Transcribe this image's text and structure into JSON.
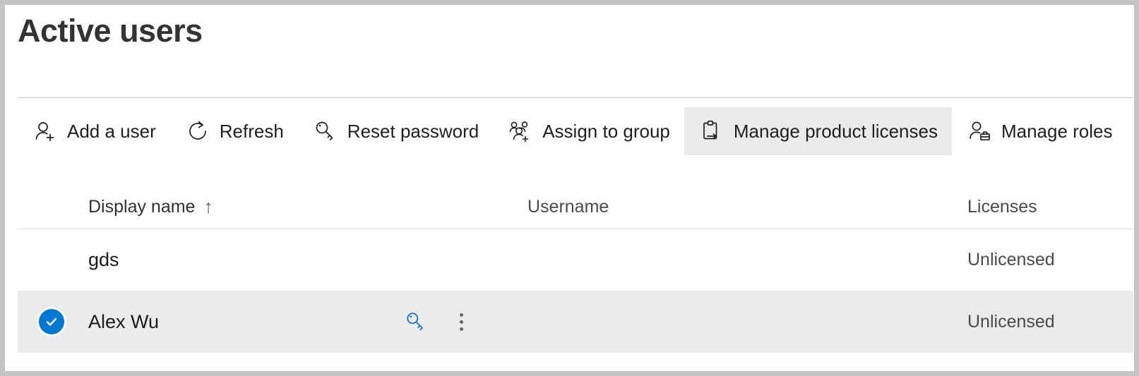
{
  "header": {
    "title": "Active users"
  },
  "toolbar": {
    "buttons": [
      {
        "label": "Add a user",
        "icon": "person-add-icon",
        "active": false
      },
      {
        "label": "Refresh",
        "icon": "refresh-icon",
        "active": false
      },
      {
        "label": "Reset password",
        "icon": "key-icon",
        "active": false
      },
      {
        "label": "Assign to group",
        "icon": "people-add-icon",
        "active": false
      },
      {
        "label": "Manage product licenses",
        "icon": "clipboard-arrow-icon",
        "active": true
      },
      {
        "label": "Manage roles",
        "icon": "person-briefcase-icon",
        "active": false
      }
    ]
  },
  "table": {
    "columns": {
      "display_name": "Display name",
      "username": "Username",
      "licenses": "Licenses"
    },
    "sort": {
      "column": "Display name",
      "direction": "ascending",
      "indicator": "↑"
    },
    "rows": [
      {
        "display_name": "gds",
        "username": "",
        "licenses": "Unlicensed",
        "selected": false
      },
      {
        "display_name": "Alex Wu",
        "username": "",
        "licenses": "Unlicensed",
        "selected": true
      }
    ],
    "row_actions": {
      "reset_password_icon": "key-icon",
      "more_options_icon": "more-vertical-icon"
    }
  },
  "colors": {
    "accent": "#0078d4",
    "selected_row_bg": "#ebebeb",
    "active_button_bg": "#ebebeb",
    "title_text": "#333333",
    "secondary_text": "#4a4a4a"
  }
}
